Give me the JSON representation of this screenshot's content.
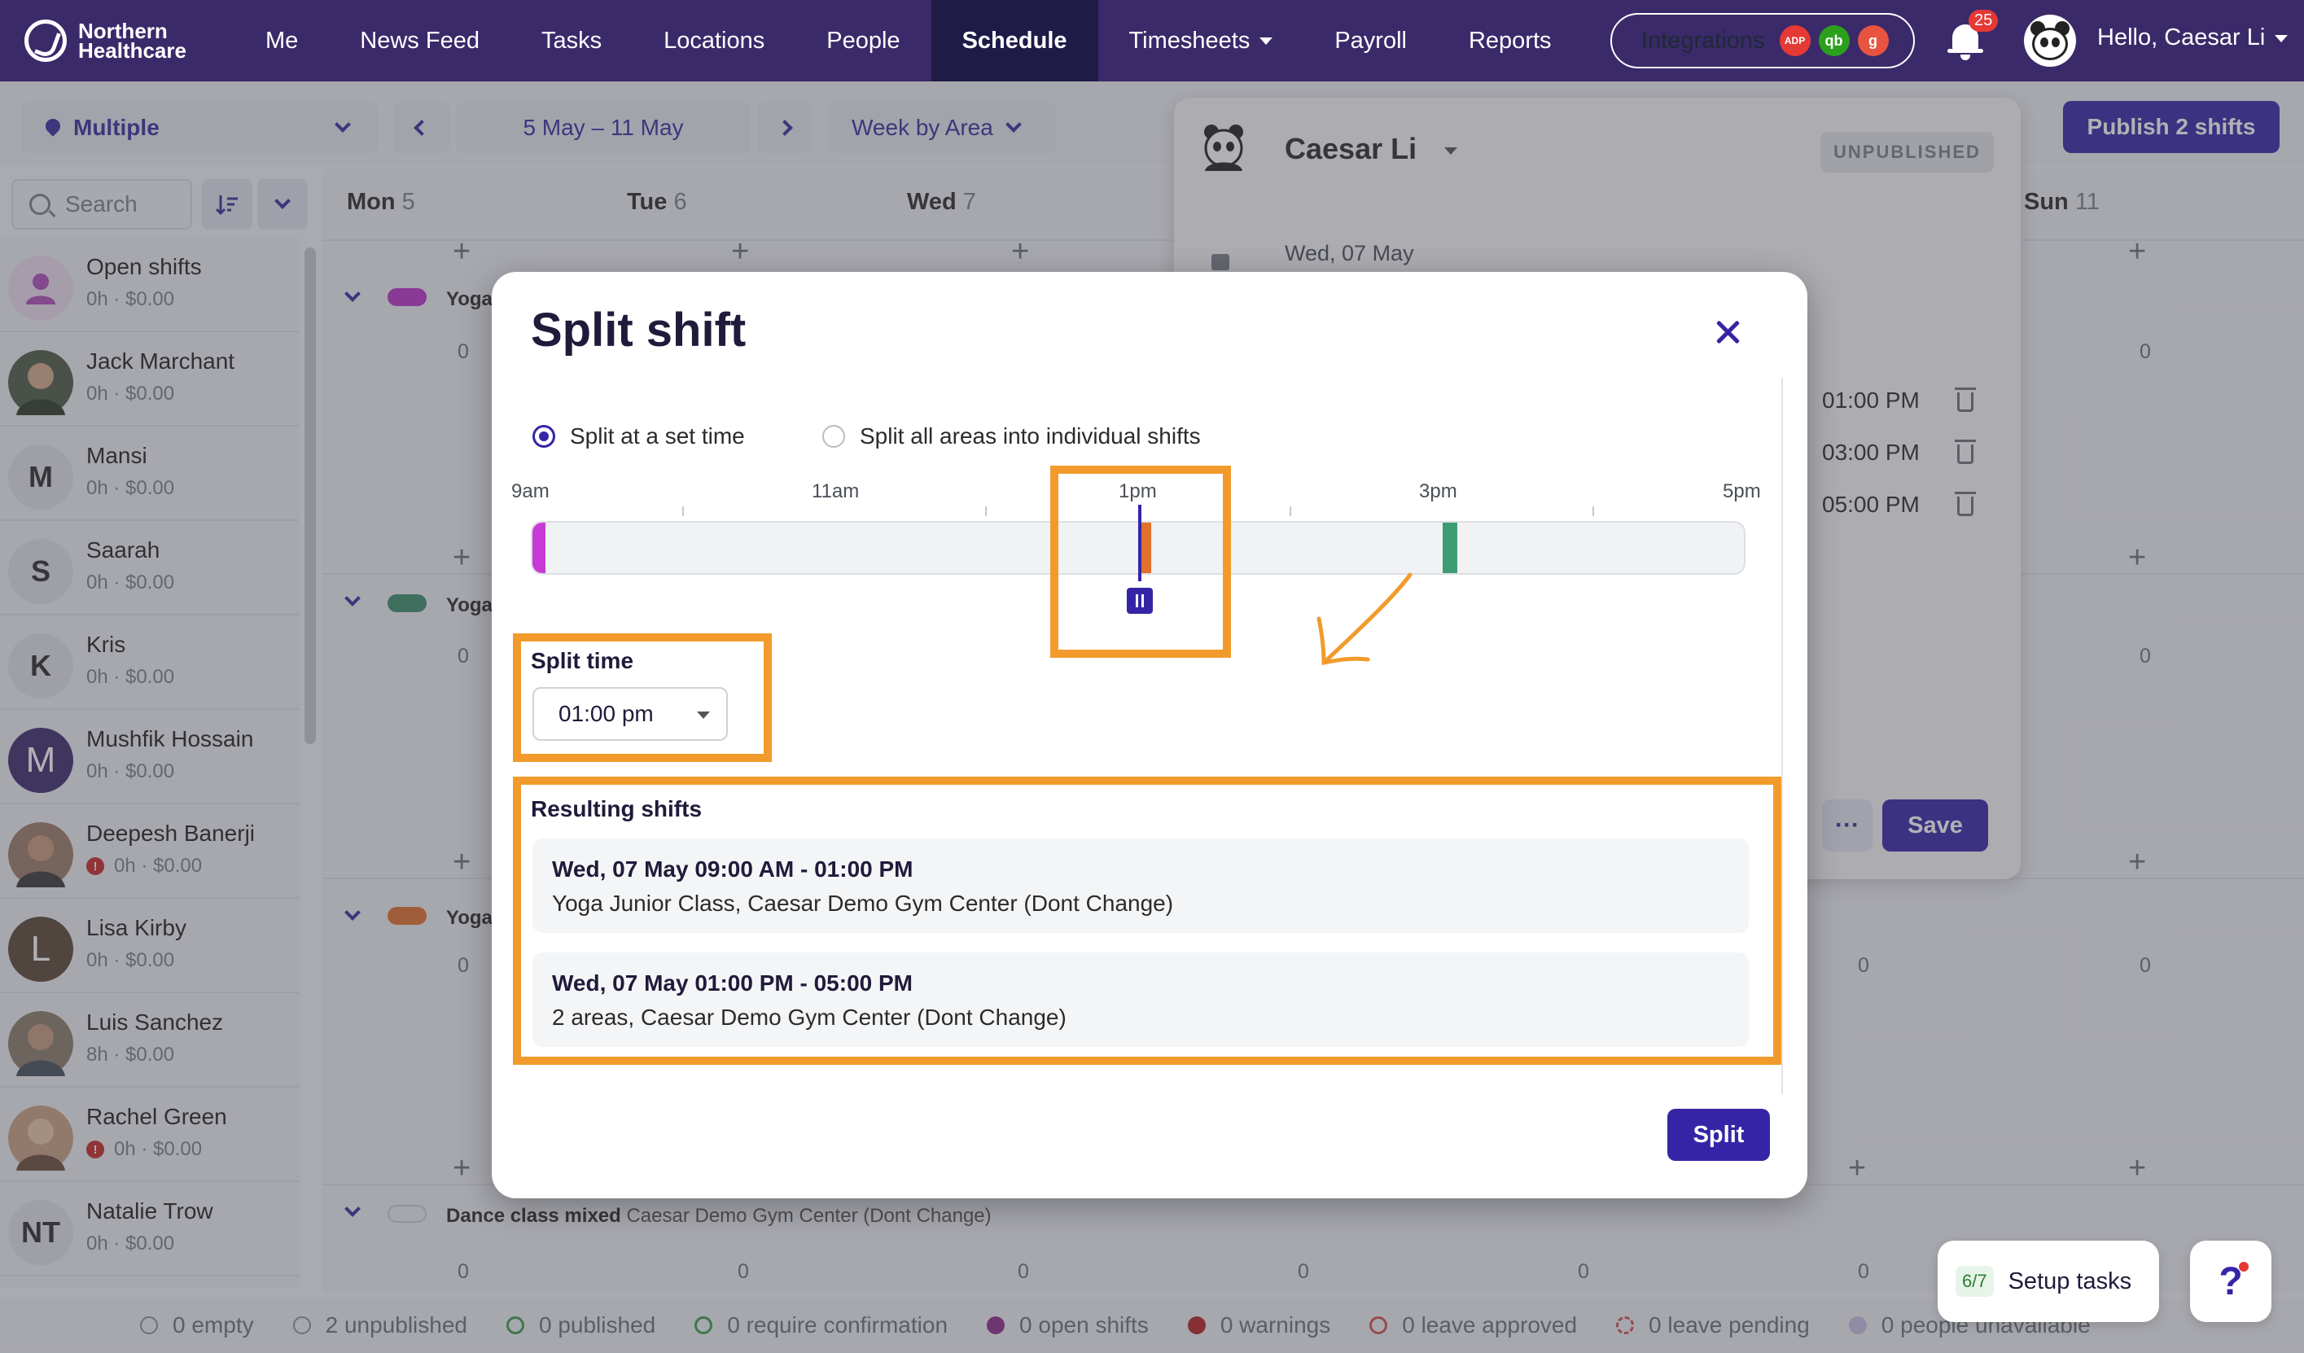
{
  "brand": {
    "line1": "Northern",
    "line2": "Healthcare"
  },
  "nav": {
    "items": [
      "Me",
      "News Feed",
      "Tasks",
      "Locations",
      "People",
      "Schedule",
      "Timesheets",
      "Payroll",
      "Reports"
    ],
    "active": "Schedule",
    "integrations_label": "Integrations",
    "integration_badges": [
      {
        "text": "ADP",
        "color": "#e53935"
      },
      {
        "text": "qb",
        "color": "#2ca01c"
      },
      {
        "text": "g",
        "color": "#e8543f"
      }
    ],
    "notification_count": "25",
    "greeting": "Hello, Caesar Li"
  },
  "toolbar": {
    "location": "Multiple",
    "date_range": "5 May – 11 May",
    "view": "Week by Area",
    "publish_label": "Publish 2 shifts",
    "search_placeholder": "Search"
  },
  "days": [
    {
      "name": "Mon",
      "num": "5"
    },
    {
      "name": "Tue",
      "num": "6"
    },
    {
      "name": "Wed",
      "num": "7"
    },
    {
      "name": "Sun",
      "num": "11"
    }
  ],
  "staff": [
    {
      "name": "Open shifts",
      "meta": "0h · $0.00",
      "initials": "",
      "color": "#e8d0e8",
      "warn": false
    },
    {
      "name": "Jack Marchant",
      "meta": "0h · $0.00",
      "initials": "",
      "color": "#5d6b4e",
      "warn": false
    },
    {
      "name": "Mansi",
      "meta": "0h · $0.00",
      "initials": "M",
      "color": "#e0e2e7",
      "warn": false
    },
    {
      "name": "Saarah",
      "meta": "0h · $0.00",
      "initials": "S",
      "color": "#e0e2e7",
      "warn": false
    },
    {
      "name": "Kris",
      "meta": "0h · $0.00",
      "initials": "K",
      "color": "#e0e2e7",
      "warn": false
    },
    {
      "name": "Mushfik Hossain",
      "meta": "0h · $0.00",
      "initials": "M",
      "color": "#3b2a6a",
      "warn": false
    },
    {
      "name": "Deepesh Banerji",
      "meta": "0h · $0.00",
      "initials": "",
      "color": "#8a6d5a",
      "warn": true
    },
    {
      "name": "Lisa Kirby",
      "meta": "0h · $0.00",
      "initials": "L",
      "color": "#5a4636",
      "warn": false
    },
    {
      "name": "Luis Sanchez",
      "meta": "8h · $0.00",
      "initials": "",
      "color": "#7a6a5a",
      "warn": false
    },
    {
      "name": "Rachel Green",
      "meta": "0h · $0.00",
      "initials": "",
      "color": "#b88a6a",
      "warn": true
    },
    {
      "name": "Natalie Trow",
      "meta": "0h · $0.00",
      "initials": "NT",
      "color": "#e0e2e7",
      "warn": false
    }
  ],
  "areas": [
    {
      "title": "Yoga",
      "color": "#b832c6"
    },
    {
      "title": "Yoga",
      "color": "#3d8c6c"
    },
    {
      "title": "Yoga",
      "color": "#e0702a"
    },
    {
      "title": "Dance class mixed",
      "subtitle": "Caesar Demo Gym Center (Dont Change)",
      "color": "#eceef1"
    }
  ],
  "side_panel": {
    "name": "Caesar Li",
    "status": "UNPUBLISHED",
    "date": "Wed, 07 May",
    "times": [
      "01:00 PM",
      "03:00 PM",
      "05:00 PM"
    ],
    "save_label": "Save",
    "more_label": "···"
  },
  "modal": {
    "title": "Split shift",
    "option_set_time": "Split at a set time",
    "option_split_areas": "Split all areas into individual shifts",
    "timeline_labels": [
      "9am",
      "11am",
      "1pm",
      "3pm",
      "5pm"
    ],
    "split_time_label": "Split time",
    "split_time_value": "01:00 pm",
    "resulting_label": "Resulting shifts",
    "results": [
      {
        "time": "Wed, 07 May 09:00 AM - 01:00 PM",
        "desc": "Yoga Junior Class, Caesar Demo Gym Center (Dont Change)"
      },
      {
        "time": "Wed, 07 May 01:00 PM - 05:00 PM",
        "desc": "2 areas, Caesar Demo Gym Center (Dont Change)"
      }
    ],
    "split_button": "Split",
    "segment_colors": [
      "#c83ad6",
      "#e0702a",
      "#3d9c74"
    ]
  },
  "status_bar": [
    {
      "label": "0 empty",
      "color": "#ffffff",
      "border": "#8a8f98"
    },
    {
      "label": "2 unpublished",
      "color": "#ffffff",
      "border": "#8a8f98"
    },
    {
      "label": "0 published",
      "color": "#ffffff",
      "border": "#3d9c4c"
    },
    {
      "label": "0 require confirmation",
      "color": "#ffffff",
      "border": "#3d9c4c"
    },
    {
      "label": "0 open shifts",
      "color": "#8e2a8e",
      "border": "#8e2a8e"
    },
    {
      "label": "0 warnings",
      "color": "#b22222",
      "border": "#b22222"
    },
    {
      "label": "0 leave approved",
      "color": "#ffffff",
      "border": "#d05050"
    },
    {
      "label": "0 leave pending",
      "color": "#ffffff",
      "border": "#d05050"
    },
    {
      "label": "0 people unavailable",
      "color": "#c8c0e0",
      "border": "#c8c0e0"
    }
  ],
  "widgets": {
    "setup_badge": "6/7",
    "setup_label": "Setup tasks",
    "help_label": "?"
  }
}
